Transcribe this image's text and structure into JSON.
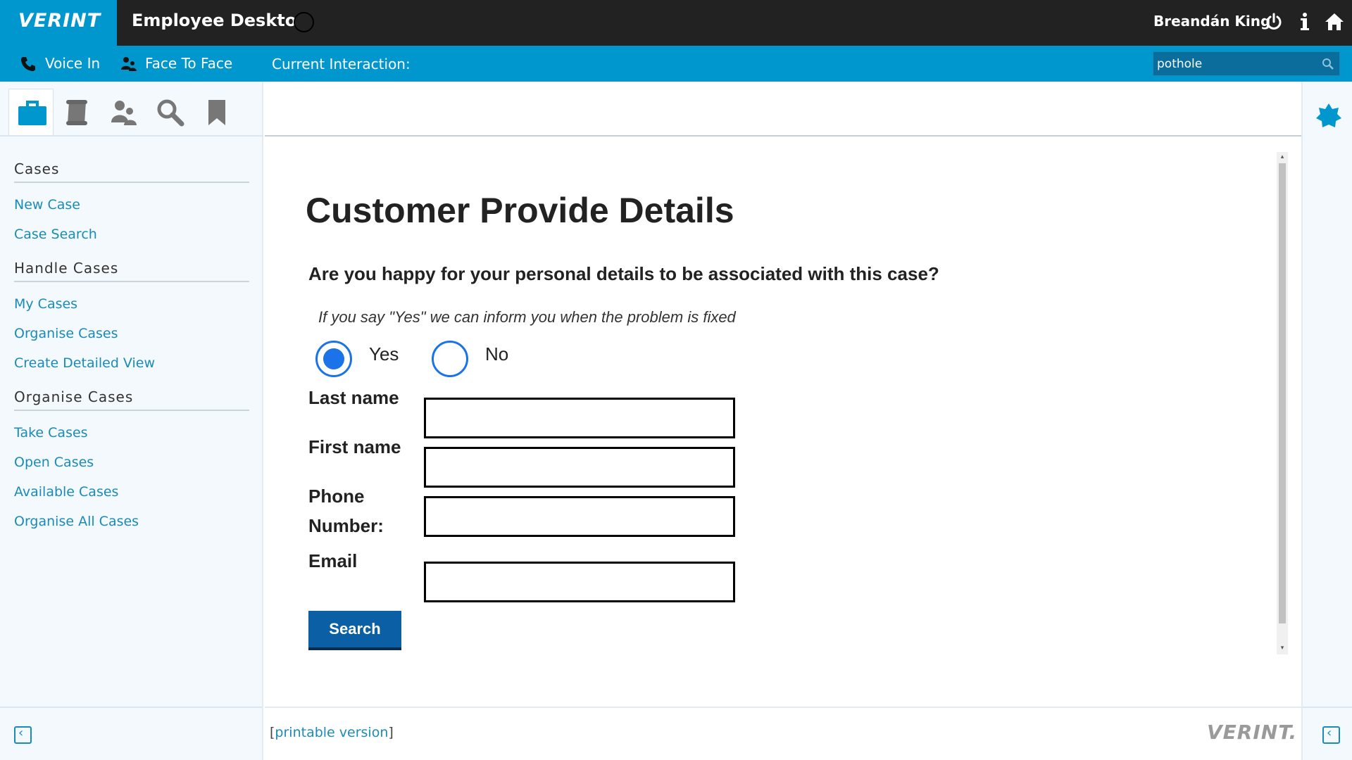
{
  "header": {
    "logo": "VERINT",
    "app_title": "Employee Desktop",
    "user_name": "Breandán King",
    "icons": [
      "power-icon",
      "info-icon",
      "home-icon"
    ]
  },
  "subbar": {
    "voice_in": "Voice In",
    "face_to_face": "Face To Face",
    "current_interaction": "Current Interaction:",
    "search_value": "pothole"
  },
  "sidebar": {
    "tools": [
      "briefcase-icon",
      "scroll-icon",
      "people-icon",
      "search-icon",
      "bookmark-icon"
    ],
    "sections": [
      {
        "title": "Cases",
        "links": [
          "New Case",
          "Case Search"
        ]
      },
      {
        "title": "Handle Cases",
        "links": [
          "My Cases",
          "Organise Cases",
          "Create Detailed View"
        ]
      },
      {
        "title": "Organise Cases",
        "links": [
          "Take Cases",
          "Open Cases",
          "Available Cases",
          "Organise All Cases"
        ]
      }
    ]
  },
  "form": {
    "title": "Customer Provide Details",
    "question": "Are you happy for your personal details to be associated with this case?",
    "hint": "If you say \"Yes\" we can inform you when the problem is fixed",
    "yes_label": "Yes",
    "no_label": "No",
    "selected": "Yes",
    "last_name_label": "Last name",
    "first_name_label": "First name",
    "phone_label_1": "Phone",
    "phone_label_2": "Number:",
    "email_label": "Email",
    "search_button": "Search"
  },
  "footer": {
    "printable_link": "printable version",
    "logo": "VERINT."
  },
  "colors": {
    "brand_blue": "#0097cf",
    "topbar_dark": "#222222",
    "link_blue": "#1a8bb8",
    "radio_blue": "#1a73e8",
    "button_blue": "#0b5fa5"
  }
}
